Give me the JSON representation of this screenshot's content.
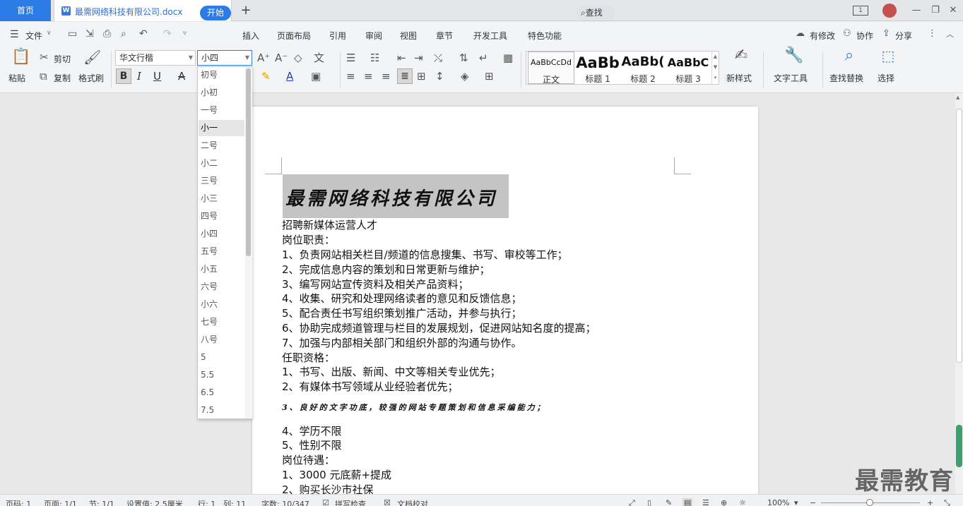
{
  "tabs": {
    "home": "首页",
    "doc_title": "最需网络科技有限公司.docx",
    "new_tab": "+"
  },
  "window": {
    "page_indicator": "1",
    "minimize": "—",
    "restore": "❐",
    "close": "✕"
  },
  "menu": {
    "file": "文件",
    "items": [
      "开始",
      "插入",
      "页面布局",
      "引用",
      "审阅",
      "视图",
      "章节",
      "开发工具",
      "特色功能"
    ],
    "search": "查找",
    "right": {
      "revise": "有修改",
      "collab": "协作",
      "share": "分享"
    }
  },
  "ribbon": {
    "paste": "粘贴",
    "cut": "剪切",
    "copy": "复制",
    "format_painter": "格式刷",
    "font_name": "华文行楷",
    "font_size": "小四",
    "bold": "B",
    "italic": "I",
    "underline": "U",
    "strike": "A",
    "styles": [
      {
        "preview": "AaBbCcDd",
        "name": "正文"
      },
      {
        "preview": "AaBb",
        "name": "标题 1"
      },
      {
        "preview": "AaBb(",
        "name": "标题 2"
      },
      {
        "preview": "AaBbC",
        "name": "标题 3"
      }
    ],
    "new_style": "新样式",
    "text_tools": "文字工具",
    "find_replace": "查找替换",
    "select": "选择"
  },
  "font_size_options": [
    "初号",
    "小初",
    "一号",
    "小一",
    "二号",
    "小二",
    "三号",
    "小三",
    "四号",
    "小四",
    "五号",
    "小五",
    "六号",
    "小六",
    "七号",
    "八号",
    "5",
    "5.5",
    "6.5",
    "7.5"
  ],
  "font_size_highlighted": "小一",
  "document": {
    "title": "最需网络科技有限公司",
    "lines": [
      "招聘新媒体运营人才",
      "岗位职责：",
      "1、负责网站相关栏目/频道的信息搜集、书写、审校等工作；",
      "2、完成信息内容的策划和日常更新与维护；",
      "3、编写网站宣传资料及相关产品资料；",
      "4、收集、研究和处理网络读者的意见和反馈信息；",
      "5、配合责任书写组织策划推广活动，并参与执行；",
      "6、协助完成频道管理与栏目的发展规划，促进网站知名度的提高；",
      "7、加强与内部相关部门和组织外部的沟通与协作。",
      "任职资格：",
      "1、书写、出版、新闻、中文等相关专业优先；",
      "2、有媒体书写领域从业经验者优先；"
    ],
    "special_line": "3、良好的文字功底，较强的网站专题策划和信息采编能力；",
    "lines_after": [
      "4、学历不限",
      "5、性别不限",
      "岗位待遇：",
      "1、3000 元底薪+提成",
      "2、购买长沙市社保"
    ]
  },
  "status": {
    "page": "页码: 1",
    "pages": "页面: 1/1",
    "section": "节: 1/1",
    "setting": "设置值: 2.5厘米",
    "row": "行: 1",
    "col": "列: 11",
    "words": "字数: 10/347",
    "spell": "拼写检查",
    "doc_check": "文档校对",
    "zoom": "100%"
  },
  "watermark": "最需教育"
}
